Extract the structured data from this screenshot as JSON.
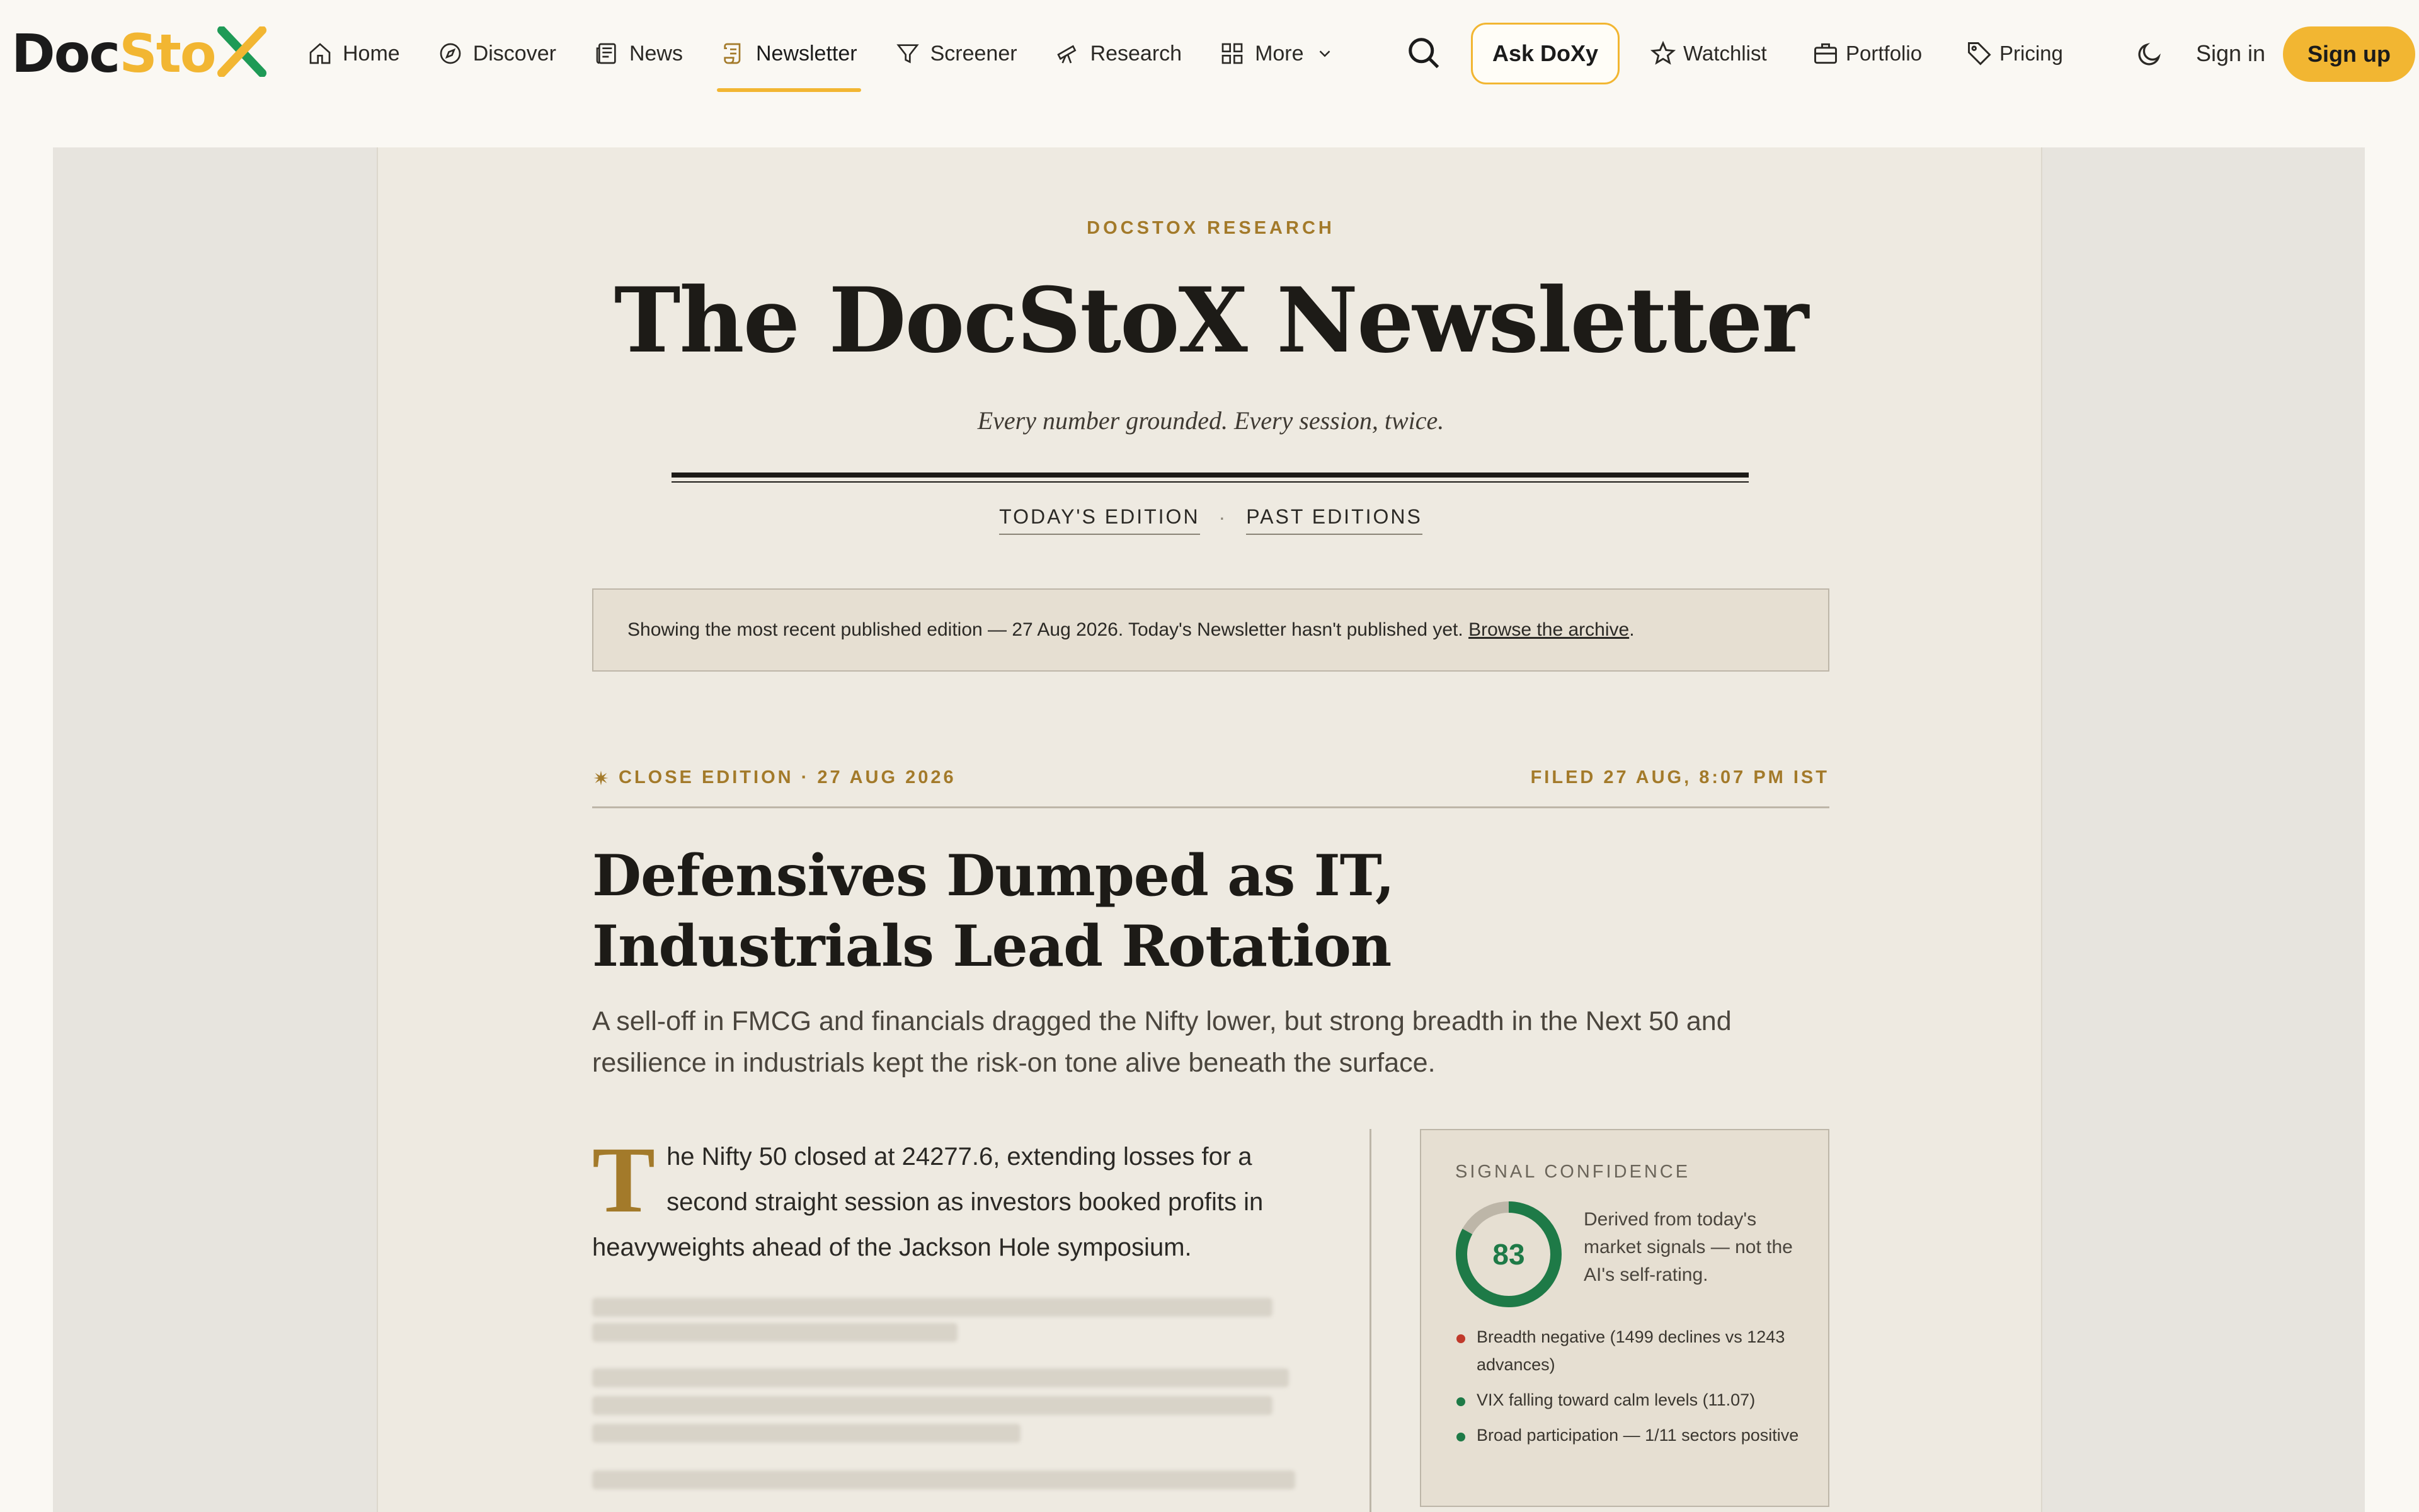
{
  "brand": {
    "logo_part1": "Doc",
    "logo_part2": "Sto",
    "logo_part3": "X"
  },
  "nav": {
    "items": [
      {
        "label": "Home",
        "icon": "home-icon"
      },
      {
        "label": "Discover",
        "icon": "compass-icon"
      },
      {
        "label": "News",
        "icon": "newspaper-icon"
      },
      {
        "label": "Newsletter",
        "icon": "scroll-icon",
        "active": true
      },
      {
        "label": "Screener",
        "icon": "filter-icon"
      },
      {
        "label": "Research",
        "icon": "telescope-icon"
      },
      {
        "label": "More",
        "icon": "grid-icon"
      }
    ]
  },
  "header": {
    "ask_label": "Ask DoXy",
    "watchlist_label": "Watchlist",
    "portfolio_label": "Portfolio",
    "pricing_label": "Pricing",
    "signin_label": "Sign in",
    "signup_label": "Sign up"
  },
  "colors": {
    "accent": "#f2b632",
    "gold_text": "#a37a2a",
    "positive": "#1e7a47",
    "negative": "#c0392b"
  },
  "masthead": {
    "kicker": "DOCSTOX RESEARCH",
    "title": "The DocStoX Newsletter",
    "tagline": "Every number grounded. Every session, twice.",
    "tabs": [
      "TODAY'S EDITION",
      "PAST EDITIONS"
    ],
    "separator": "·"
  },
  "notice": {
    "text": "Showing the most recent published edition — 27 Aug 2026. Today's Newsletter hasn't published yet. ",
    "link": "Browse the archive",
    "tail": "."
  },
  "edition": {
    "label": "CLOSE EDITION · 27 AUG 2026",
    "filed": "FILED 27 AUG, 8:07 PM IST"
  },
  "article": {
    "headline_line1": "Defensives Dumped as IT,",
    "headline_line2": "Industrials Lead Rotation",
    "dek": "A sell-off in FMCG and financials dragged the Nifty lower, but strong breadth in the Next 50 and resilience in industrials kept the risk-on tone alive beneath the surface.",
    "dropcap": "T",
    "lead": "he Nifty 50 closed at 24277.6, extending losses for a second straight session as investors booked profits in heavyweights ahead of the Jackson Hole symposium."
  },
  "signal": {
    "title": "SIGNAL CONFIDENCE",
    "score": "83",
    "score_fraction": 0.83,
    "description": "Derived from today's market signals — not the AI's self-rating.",
    "items": [
      {
        "text": "Breadth negative (1499 declines vs 1243 advances)",
        "status": "negative"
      },
      {
        "text": "VIX falling toward calm levels (11.07)",
        "status": "positive"
      },
      {
        "text": "Broad participation — 1/11 sectors positive",
        "status": "positive"
      }
    ]
  }
}
